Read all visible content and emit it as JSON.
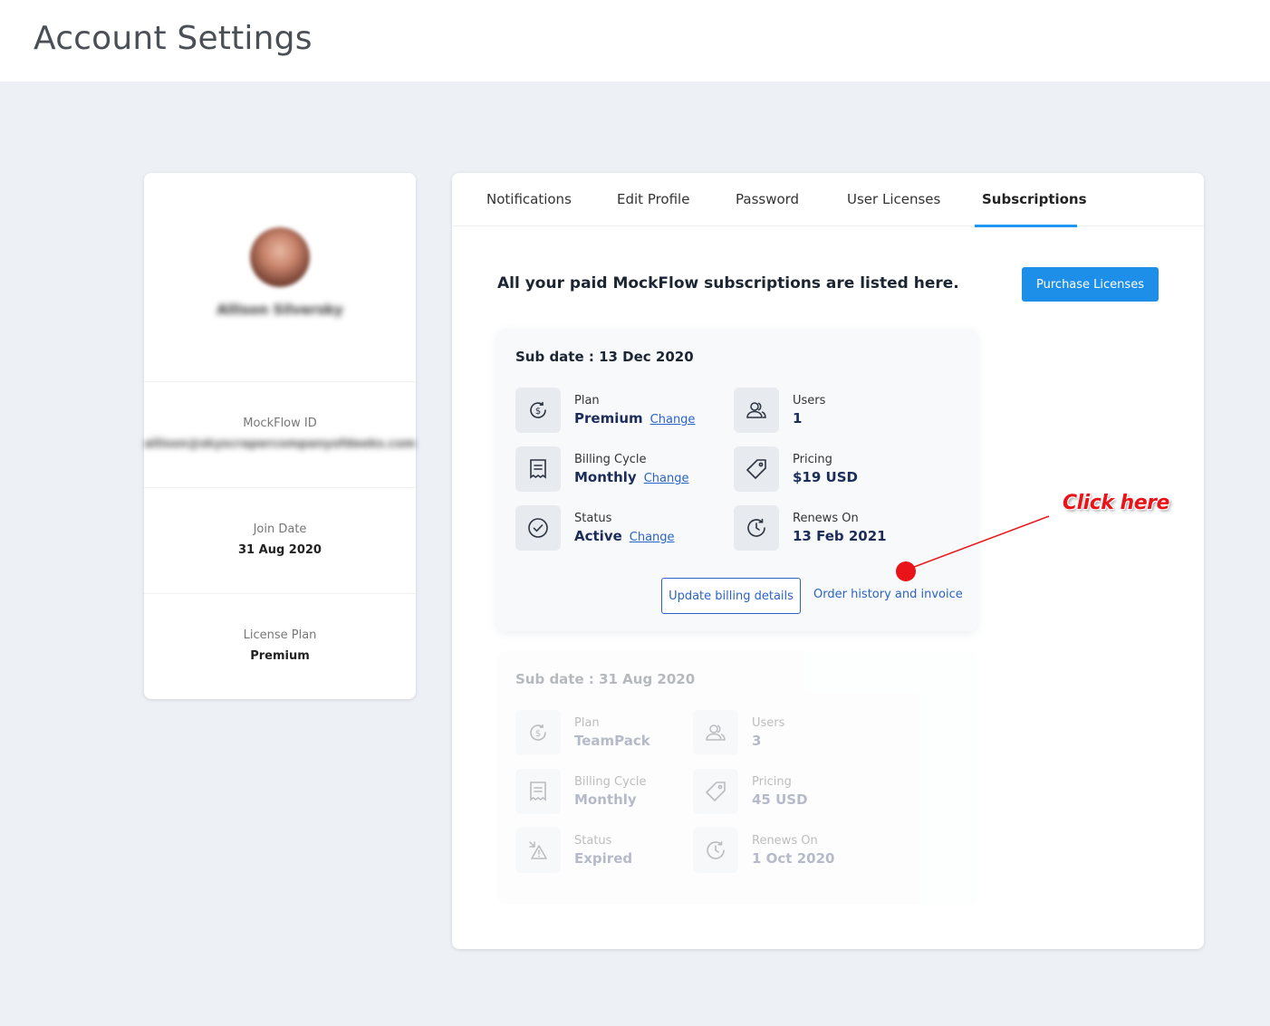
{
  "page": {
    "title": "Account Settings"
  },
  "profile": {
    "name": "Allison Silversky",
    "mockflow_id_label": "MockFlow ID",
    "mockflow_id_value": "allison@skyscrapercompanyofdeeks.com",
    "join_date_label": "Join Date",
    "join_date_value": "31 Aug 2020",
    "license_plan_label": "License Plan",
    "license_plan_value": "Premium"
  },
  "tabs": [
    {
      "label": "Notifications",
      "active": false
    },
    {
      "label": "Edit Profile",
      "active": false
    },
    {
      "label": "Password",
      "active": false
    },
    {
      "label": "User Licenses",
      "active": false
    },
    {
      "label": "Subscriptions",
      "active": true
    }
  ],
  "subscriptions": {
    "intro": "All your paid MockFlow subscriptions are listed here.",
    "purchase_label": "Purchase Licenses",
    "cards": [
      {
        "sub_date": "Sub date :  13 Dec 2020",
        "plan_label": "Plan",
        "plan_value": "Premium",
        "users_label": "Users",
        "users_value": "1",
        "billing_label": "Billing Cycle",
        "billing_value": "Monthly",
        "pricing_label": "Pricing",
        "pricing_value": "$19 USD",
        "status_label": "Status",
        "status_value": "Active",
        "renews_label": "Renews On",
        "renews_value": "13  Feb 2021",
        "change_label": "Change",
        "update_label": "Update billing details",
        "order_label": "Order history and invoice"
      },
      {
        "sub_date": "Sub date :  31 Aug 2020",
        "plan_label": "Plan",
        "plan_value": "TeamPack",
        "users_label": "Users",
        "users_value": "3",
        "billing_label": "Billing Cycle",
        "billing_value": "Monthly",
        "pricing_label": "Pricing",
        "pricing_value": "45 USD",
        "status_label": "Status",
        "status_value": "Expired",
        "renews_label": "Renews On",
        "renews_value": "1  Oct 2020"
      }
    ]
  },
  "annotation": {
    "text": "Click here",
    "color": "#e8141a"
  },
  "colors": {
    "accent": "#1e8fe8",
    "link": "#2a63c8",
    "background": "#edf1f6"
  }
}
